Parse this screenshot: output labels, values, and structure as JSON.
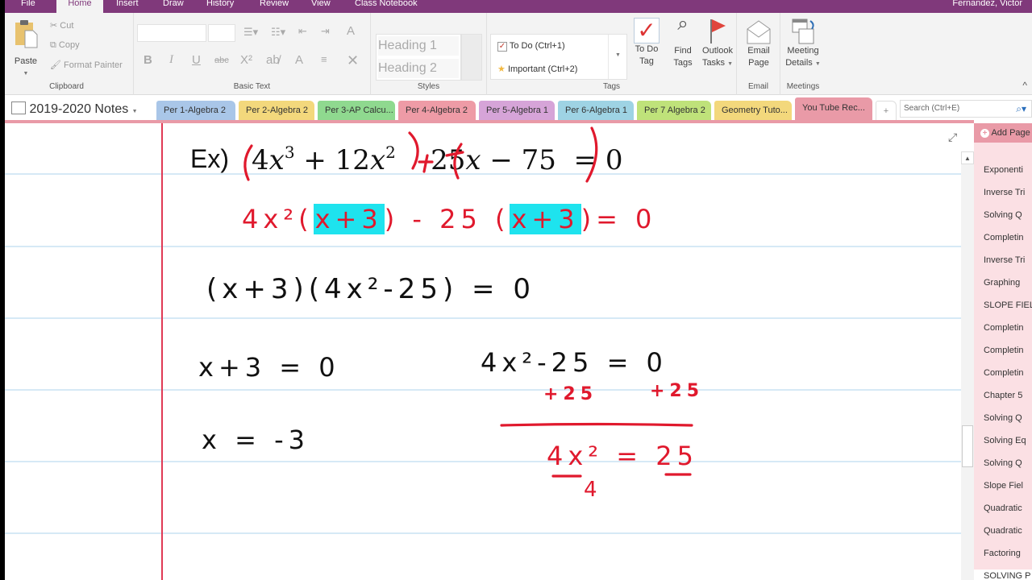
{
  "menubar": {
    "tabs": [
      "File",
      "Home",
      "Insert",
      "Draw",
      "History",
      "Review",
      "View",
      "Class Notebook"
    ],
    "active": "Home",
    "user": "Fernandez, Victor"
  },
  "ribbon": {
    "clipboard": {
      "paste": "Paste",
      "cut": "Cut",
      "copy": "Copy",
      "format_painter": "Format Painter",
      "label": "Clipboard"
    },
    "basic_text": {
      "label": "Basic Text",
      "bold": "B",
      "italic": "I",
      "underline": "U",
      "strike": "abc",
      "superscript": "X²",
      "font_color": "A",
      "clear": "✕"
    },
    "styles": {
      "heading1": "Heading 1",
      "heading2": "Heading 2",
      "label": "Styles"
    },
    "tags": {
      "todo": "To Do (Ctrl+1)",
      "important": "Important (Ctrl+2)",
      "todo_tag": [
        "To Do",
        "Tag"
      ],
      "find_tags": [
        "Find",
        "Tags"
      ],
      "outlook_tasks": [
        "Outlook",
        "Tasks"
      ],
      "label": "Tags"
    },
    "email": {
      "email_page": [
        "Email",
        "Page"
      ],
      "label": "Email"
    },
    "meetings": {
      "meeting_details": [
        "Meeting",
        "Details"
      ],
      "label": "Meetings"
    }
  },
  "notebook": {
    "title": "2019-2020 Notes",
    "sections": [
      {
        "label": "Per 1-Algebra 2",
        "color": "#a9c6e8"
      },
      {
        "label": "Per 2-Algebra 2",
        "color": "#f3d87c"
      },
      {
        "label": "Per 3-AP Calcu...",
        "color": "#8fd98f"
      },
      {
        "label": "Per 4-Algebra 2",
        "color": "#ee9ba6"
      },
      {
        "label": "Per 5-Algebra 1",
        "color": "#d6a4d8"
      },
      {
        "label": "Per 6-Algebra 1",
        "color": "#9ed3e4"
      },
      {
        "label": "Per 7 Algebra 2",
        "color": "#bfe27a"
      },
      {
        "label": "Geometry Tuto...",
        "color": "#f3d87c"
      },
      {
        "label": "You Tube Rec...",
        "color": "#e99aa7"
      }
    ],
    "add_section": "+",
    "search_placeholder": "Search (Ctrl+E)"
  },
  "pages": {
    "add_page": "Add Page",
    "items": [
      "Exponenti",
      "Inverse Tri",
      "Solving Q",
      "Completin",
      "Inverse Tri",
      "Graphing",
      "SLOPE FIEL",
      "Completin",
      "Completin",
      "Completin",
      "Chapter 5",
      "Solving Q",
      "Solving Eq",
      "Solving Q",
      "Slope Fiel",
      "Quadratic",
      "Quadratic",
      "Factoring",
      "SOLVING P"
    ],
    "selected_index": 18
  },
  "content": {
    "example_prefix": "Ex)",
    "typed_equation": "(4x³ + 12x²) + (25x − 75) = 0",
    "step1": "4x²(x+3) - 25(x+3) = 0",
    "step2": "(x+3)(4x²-25) = 0",
    "left_eq1": "x+3 = 0",
    "left_eq2": "x = -3",
    "right_eq1": "4x²-25 = 0",
    "right_add": "+25",
    "right_eq2": "4x² = 25",
    "right_div": "4",
    "highlight_color": "#1ee3ee",
    "red_ink": "#e0192d"
  }
}
